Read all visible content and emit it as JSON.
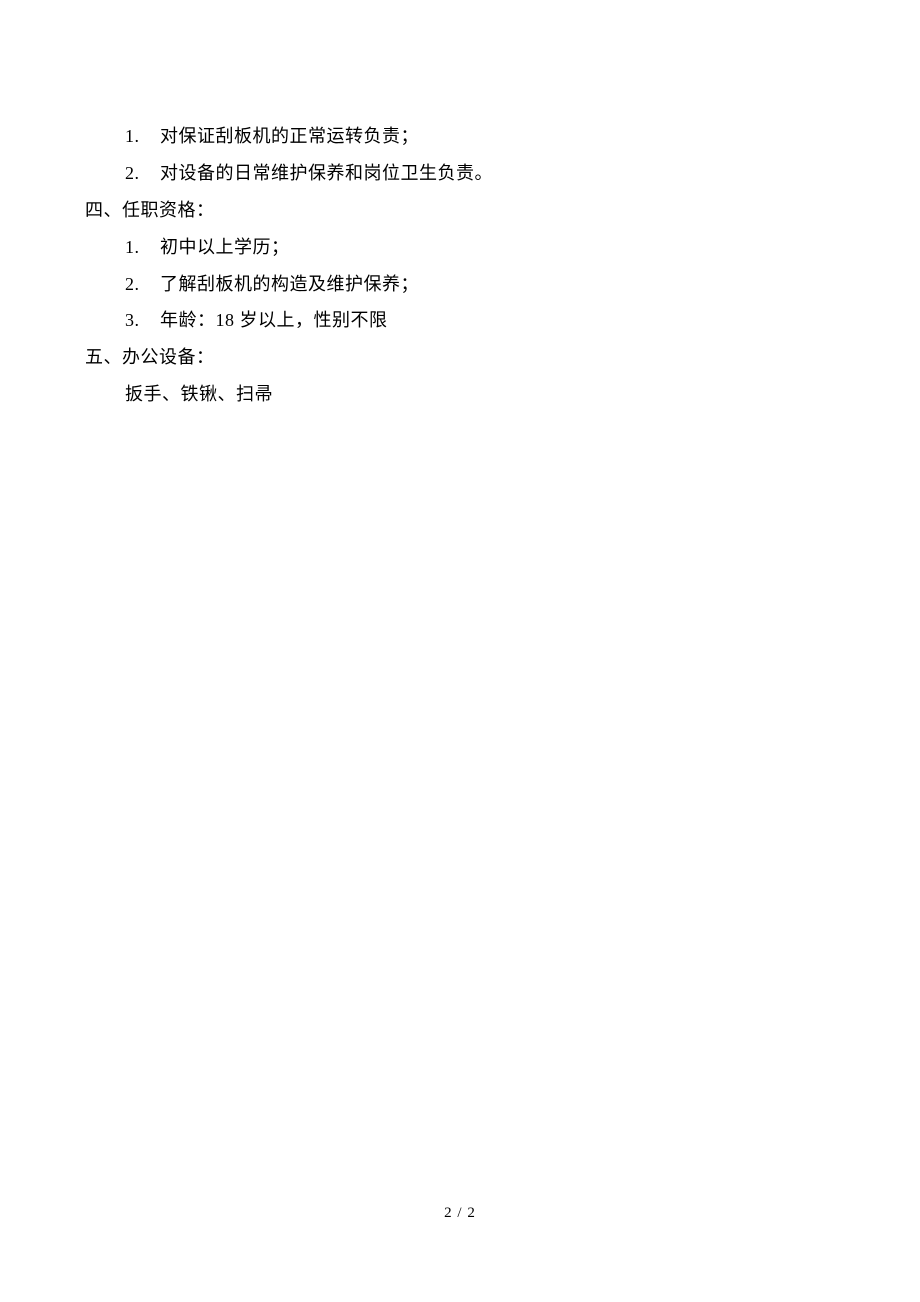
{
  "section1": {
    "items": [
      {
        "num": "1.",
        "text": "对保证刮板机的正常运转负责；"
      },
      {
        "num": "2.",
        "text": "对设备的日常维护保养和岗位卫生负责。"
      }
    ]
  },
  "section2": {
    "heading": "四、任职资格：",
    "items": [
      {
        "num": "1.",
        "text": "初中以上学历；"
      },
      {
        "num": "2.",
        "text": "了解刮板机的构造及维护保养；"
      },
      {
        "num": "3.",
        "text": "年龄：18 岁以上，性别不限"
      }
    ]
  },
  "section3": {
    "heading": "五、办公设备：",
    "body": "扳手、铁锹、扫帚"
  },
  "footer": "2  /  2"
}
